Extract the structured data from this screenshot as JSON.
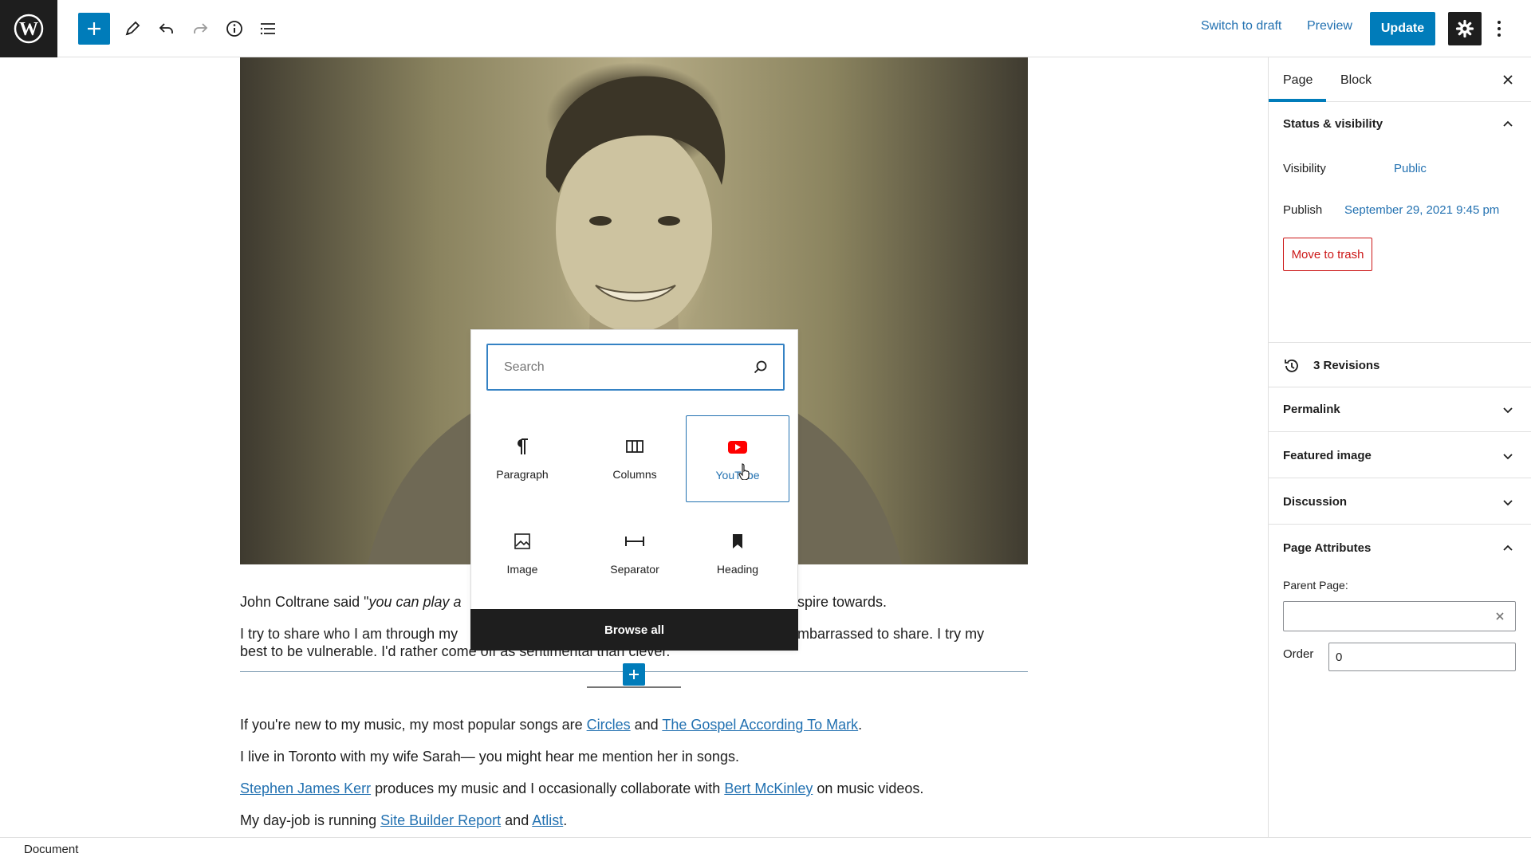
{
  "toolbar": {
    "switch_to_draft": "Switch to draft",
    "preview": "Preview",
    "update": "Update"
  },
  "content": {
    "quote_prefix": "John Coltrane said \"",
    "quote_italic": "you can play a",
    "quote_suffix": "spire towards.",
    "para2_line1_start": "I try to share who I am through my",
    "para2_line1_end": "mbarrassed to share. I try my",
    "para2_line2": "best to be vulnerable. I'd rather come off as sentimental than clever.",
    "para3_text1": "If you're new to my music, my most popular songs are ",
    "para3_link1": "Circles",
    "para3_text2": " and ",
    "para3_link2": "The Gospel According To Mark",
    "para3_text3": ".",
    "para4": "I live in Toronto with my wife Sarah— you might hear me mention her in songs.",
    "para5_link1": "Stephen James Kerr",
    "para5_text1": " produces my music and I occasionally collaborate with ",
    "para5_link2": "Bert McKinley",
    "para5_text2": " on music videos.",
    "para6_text1": "My day-job is running ",
    "para6_link1": "Site Builder Report",
    "para6_text2": " and ",
    "para6_link2": "Atlist",
    "para6_text3": "."
  },
  "inserter": {
    "search_placeholder": "Search",
    "blocks": [
      {
        "label": "Paragraph",
        "icon": "paragraph-icon"
      },
      {
        "label": "Columns",
        "icon": "columns-icon"
      },
      {
        "label": "YouTube",
        "icon": "youtube-icon"
      },
      {
        "label": "Image",
        "icon": "image-icon"
      },
      {
        "label": "Separator",
        "icon": "separator-icon"
      },
      {
        "label": "Heading",
        "icon": "bookmark-icon"
      }
    ],
    "browse_all": "Browse all"
  },
  "sidebar": {
    "tabs": [
      "Page",
      "Block"
    ],
    "status_visibility": {
      "title": "Status & visibility",
      "visibility_label": "Visibility",
      "visibility_value": "Public",
      "publish_label": "Publish",
      "publish_value": "September 29, 2021 9:45 pm",
      "trash": "Move to trash"
    },
    "revisions": "3 Revisions",
    "panels": [
      "Permalink",
      "Featured image",
      "Discussion"
    ],
    "page_attributes": {
      "title": "Page Attributes",
      "parent_label": "Parent Page:",
      "order_label": "Order",
      "order_value": "0"
    }
  },
  "footer": {
    "breadcrumb": "Document"
  },
  "colors": {
    "accent": "#007cba",
    "link": "#2271b1",
    "danger": "#cc1818",
    "youtube": "#ff0000",
    "dark": "#1e1e1e"
  }
}
